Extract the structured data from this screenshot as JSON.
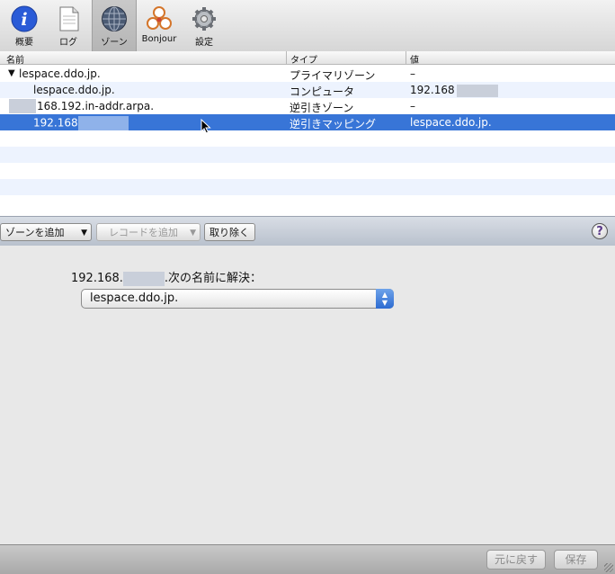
{
  "toolbar": {
    "items": [
      {
        "label": "概要",
        "icon": "info-icon"
      },
      {
        "label": "ログ",
        "icon": "document-icon"
      },
      {
        "label": "ゾーン",
        "icon": "globe-icon",
        "selected": true
      },
      {
        "label": "Bonjour",
        "icon": "bonjour-icon"
      },
      {
        "label": "設定",
        "icon": "gear-icon"
      }
    ]
  },
  "table": {
    "columns": [
      "名前",
      "タイプ",
      "値"
    ],
    "rows": [
      {
        "name": "lespace.ddo.jp.",
        "type": "プライマリゾーン",
        "value": "–"
      },
      {
        "name": "lespace.ddo.jp.",
        "type": "コンピュータ",
        "value": "192.168"
      },
      {
        "name": "168.192.in-addr.arpa.",
        "type": "逆引きゾーン",
        "value": "–"
      },
      {
        "name": "192.168",
        "type": "逆引きマッピング",
        "value": "lespace.ddo.jp."
      }
    ]
  },
  "buttons": {
    "add_zone": "ゾーンを追加",
    "add_record": "レコードを追加",
    "remove": "取り除く",
    "help": "?"
  },
  "detail": {
    "ip_prefix": "192.168.",
    "resolve_label": ".次の名前に解決：",
    "selected_name": "lespace.ddo.jp."
  },
  "footer": {
    "revert": "元に戻す",
    "save": "保存"
  },
  "colors": {
    "selection": "#3875d7",
    "alt_row": "#edf3fe"
  }
}
